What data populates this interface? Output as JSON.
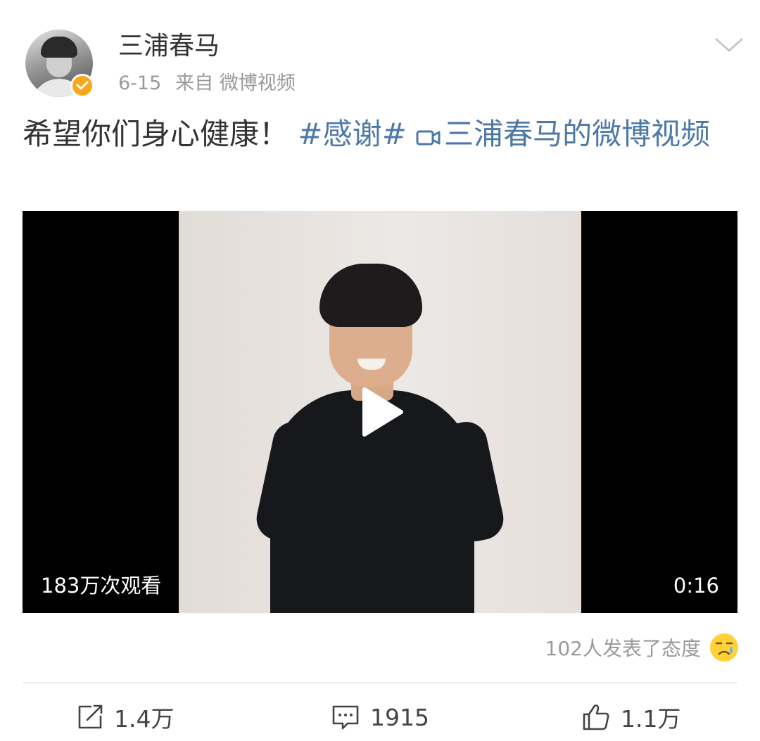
{
  "post": {
    "username": "三浦春马",
    "date": "6-15",
    "source": "来自 微博视频",
    "text": "希望你们身心健康！",
    "hashtag": "#感谢#",
    "video_link_text": "三浦春马的微博视频"
  },
  "video": {
    "views": "183万次观看",
    "duration": "0:16"
  },
  "reactions": {
    "text": "102人发表了态度"
  },
  "actions": {
    "repost_count": "1.4万",
    "comment_count": "1915",
    "like_count": "1.1万"
  },
  "icons": {
    "verified": "verified-badge-icon",
    "chevron": "chevron-down-icon",
    "video_link": "video-camera-icon",
    "play": "play-icon",
    "reaction": "crying-emoji-icon",
    "repost": "repost-icon",
    "comment": "comment-icon",
    "like": "thumbs-up-icon"
  },
  "colors": {
    "link": "#4e79a7",
    "verified": "#f7a81a",
    "muted": "#9a9a9a"
  }
}
